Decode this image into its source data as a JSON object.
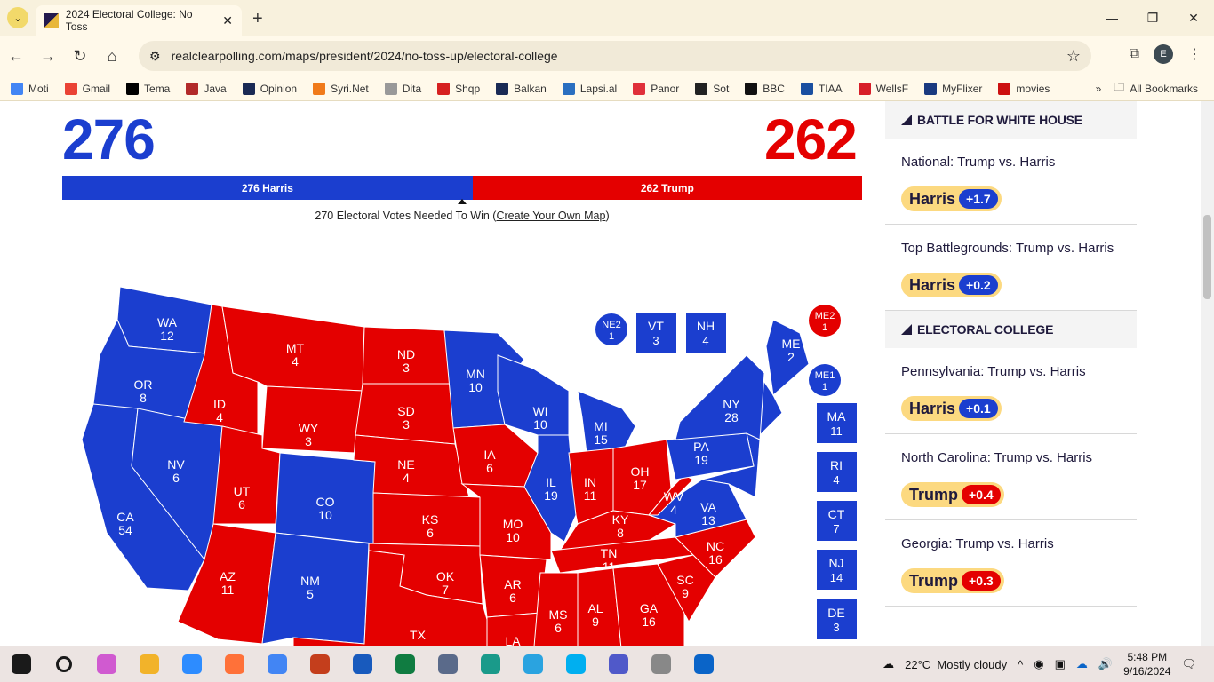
{
  "browser": {
    "tab_title": "2024 Electoral College: No Toss",
    "url": "realclearpolling.com/maps/president/2024/no-toss-up/electoral-college",
    "profile_initial": "E",
    "bookmarks": [
      {
        "label": "Moti",
        "icon": "google-icon",
        "color": "#4285f4"
      },
      {
        "label": "Gmail",
        "icon": "gmail-icon",
        "color": "#ea4335"
      },
      {
        "label": "Tema",
        "icon": "tema-icon",
        "color": "#000000"
      },
      {
        "label": "Java",
        "icon": "java-icon",
        "color": "#b22a2a"
      },
      {
        "label": "Opinion",
        "icon": "opinion-icon",
        "color": "#1a2a55"
      },
      {
        "label": "Syri.Net",
        "icon": "syri-icon",
        "color": "#f07a1a"
      },
      {
        "label": "Dita",
        "icon": "dita-icon",
        "color": "#999999"
      },
      {
        "label": "Shqp",
        "icon": "shqp-icon",
        "color": "#d62020"
      },
      {
        "label": "Balkan",
        "icon": "balkan-icon",
        "color": "#1a2a55"
      },
      {
        "label": "Lapsi.al",
        "icon": "lapsi-icon",
        "color": "#2a6fc0"
      },
      {
        "label": "Panor",
        "icon": "panorama-icon",
        "color": "#e0303a"
      },
      {
        "label": "Sot",
        "icon": "sot-icon",
        "color": "#222222"
      },
      {
        "label": "BBC",
        "icon": "bbc-icon",
        "color": "#111111"
      },
      {
        "label": "TIAA",
        "icon": "tiaa-icon",
        "color": "#1a4fa0"
      },
      {
        "label": "WellsF",
        "icon": "wellsfargo-icon",
        "color": "#d71e28"
      },
      {
        "label": "MyFlixer",
        "icon": "myflixer-icon",
        "color": "#1a3a80"
      },
      {
        "label": "movies",
        "icon": "movies-icon",
        "color": "#cc1010"
      }
    ],
    "all_bookmarks": "All Bookmarks"
  },
  "summary": {
    "harris_total": "276",
    "trump_total": "262",
    "harris_bar": "276 Harris",
    "trump_bar": "262 Trump",
    "harris_votes": 276,
    "trump_votes": 262,
    "needed_text": "270 Electoral Votes Needed To Win (",
    "create_link": "Create Your Own Map",
    "needed_close": ")",
    "colors": {
      "dem": "#1b3ecf",
      "rep": "#e40000"
    }
  },
  "states": [
    {
      "abbr": "WA",
      "ev": "12",
      "party": "D"
    },
    {
      "abbr": "OR",
      "ev": "8",
      "party": "D"
    },
    {
      "abbr": "CA",
      "ev": "54",
      "party": "D"
    },
    {
      "abbr": "NV",
      "ev": "6",
      "party": "D"
    },
    {
      "abbr": "ID",
      "ev": "4",
      "party": "R"
    },
    {
      "abbr": "MT",
      "ev": "4",
      "party": "R"
    },
    {
      "abbr": "WY",
      "ev": "3",
      "party": "R"
    },
    {
      "abbr": "UT",
      "ev": "6",
      "party": "R"
    },
    {
      "abbr": "CO",
      "ev": "10",
      "party": "D"
    },
    {
      "abbr": "AZ",
      "ev": "11",
      "party": "R"
    },
    {
      "abbr": "NM",
      "ev": "5",
      "party": "D"
    },
    {
      "abbr": "ND",
      "ev": "3",
      "party": "R"
    },
    {
      "abbr": "SD",
      "ev": "3",
      "party": "R"
    },
    {
      "abbr": "NE",
      "ev": "4",
      "party": "R"
    },
    {
      "abbr": "KS",
      "ev": "6",
      "party": "R"
    },
    {
      "abbr": "OK",
      "ev": "7",
      "party": "R"
    },
    {
      "abbr": "TX",
      "ev": "",
      "party": "R"
    },
    {
      "abbr": "MN",
      "ev": "10",
      "party": "D"
    },
    {
      "abbr": "IA",
      "ev": "6",
      "party": "R"
    },
    {
      "abbr": "MO",
      "ev": "10",
      "party": "R"
    },
    {
      "abbr": "AR",
      "ev": "6",
      "party": "R"
    },
    {
      "abbr": "LA",
      "ev": "",
      "party": "R"
    },
    {
      "abbr": "WI",
      "ev": "10",
      "party": "D"
    },
    {
      "abbr": "IL",
      "ev": "19",
      "party": "D"
    },
    {
      "abbr": "MI",
      "ev": "15",
      "party": "D"
    },
    {
      "abbr": "IN",
      "ev": "11",
      "party": "R"
    },
    {
      "abbr": "OH",
      "ev": "17",
      "party": "R"
    },
    {
      "abbr": "KY",
      "ev": "8",
      "party": "R"
    },
    {
      "abbr": "TN",
      "ev": "11",
      "party": "R"
    },
    {
      "abbr": "MS",
      "ev": "6",
      "party": "R"
    },
    {
      "abbr": "AL",
      "ev": "9",
      "party": "R"
    },
    {
      "abbr": "GA",
      "ev": "16",
      "party": "R"
    },
    {
      "abbr": "SC",
      "ev": "9",
      "party": "R"
    },
    {
      "abbr": "NC",
      "ev": "16",
      "party": "R"
    },
    {
      "abbr": "VA",
      "ev": "13",
      "party": "D"
    },
    {
      "abbr": "WV",
      "ev": "4",
      "party": "R"
    },
    {
      "abbr": "PA",
      "ev": "19",
      "party": "D"
    },
    {
      "abbr": "NY",
      "ev": "28",
      "party": "D"
    },
    {
      "abbr": "ME",
      "ev": "2",
      "party": "D"
    }
  ],
  "small_states": [
    {
      "abbr": "VT",
      "ev": "3",
      "party": "D"
    },
    {
      "abbr": "NH",
      "ev": "4",
      "party": "D"
    },
    {
      "abbr": "MA",
      "ev": "11",
      "party": "D"
    },
    {
      "abbr": "RI",
      "ev": "4",
      "party": "D"
    },
    {
      "abbr": "CT",
      "ev": "7",
      "party": "D"
    },
    {
      "abbr": "NJ",
      "ev": "14",
      "party": "D"
    },
    {
      "abbr": "DE",
      "ev": "3",
      "party": "D"
    }
  ],
  "districts": [
    {
      "abbr": "NE2",
      "ev": "1",
      "party": "D"
    },
    {
      "abbr": "ME2",
      "ev": "1",
      "party": "R"
    },
    {
      "abbr": "ME1",
      "ev": "1",
      "party": "D"
    }
  ],
  "sidebar": {
    "sections": [
      {
        "title": "BATTLE FOR WHITE HOUSE",
        "races": [
          {
            "title": "National: Trump vs. Harris",
            "leader": "Harris",
            "spread": "+1.7",
            "party": "D"
          },
          {
            "title": "Top Battlegrounds: Trump vs. Harris",
            "leader": "Harris",
            "spread": "+0.2",
            "party": "D"
          }
        ]
      },
      {
        "title": "ELECTORAL COLLEGE",
        "races": [
          {
            "title": "Pennsylvania: Trump vs. Harris",
            "leader": "Harris",
            "spread": "+0.1",
            "party": "D"
          },
          {
            "title": "North Carolina: Trump vs. Harris",
            "leader": "Trump",
            "spread": "+0.4",
            "party": "R"
          },
          {
            "title": "Georgia: Trump vs. Harris",
            "leader": "Trump",
            "spread": "+0.3",
            "party": "R"
          }
        ]
      }
    ]
  },
  "taskbar": {
    "apps": [
      {
        "name": "start",
        "color": "#1a1a1a"
      },
      {
        "name": "search",
        "color": "#1a1a1a"
      },
      {
        "name": "copilot",
        "color": "#d05ad0"
      },
      {
        "name": "file-explorer",
        "color": "#f2b32a"
      },
      {
        "name": "zoom",
        "color": "#2d8cff"
      },
      {
        "name": "firefox",
        "color": "#ff7139"
      },
      {
        "name": "chrome",
        "color": "#4285f4"
      },
      {
        "name": "powerpoint",
        "color": "#c43e1c"
      },
      {
        "name": "word",
        "color": "#185abd"
      },
      {
        "name": "excel",
        "color": "#107c41"
      },
      {
        "name": "calculator",
        "color": "#5a6a8a"
      },
      {
        "name": "edge",
        "color": "#1a9a8a"
      },
      {
        "name": "telegram",
        "color": "#2aa3e0"
      },
      {
        "name": "skype",
        "color": "#00aff0"
      },
      {
        "name": "teams",
        "color": "#5059c9"
      },
      {
        "name": "fax",
        "color": "#888888"
      },
      {
        "name": "outlook",
        "color": "#0a64c8"
      }
    ],
    "weather": "22°C  Mostly cloudy",
    "weather_badge": "1",
    "time": "5:48 PM",
    "date": "9/16/2024",
    "notifications": "1"
  }
}
